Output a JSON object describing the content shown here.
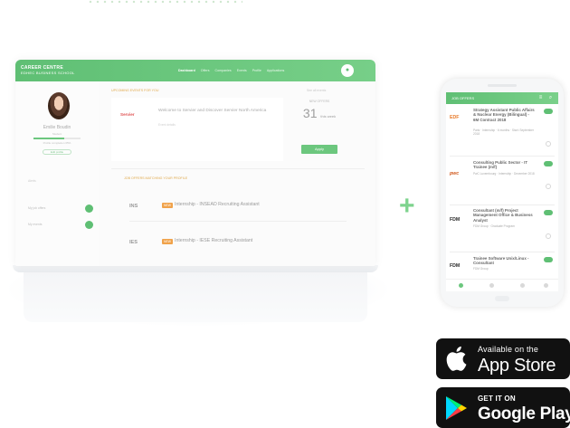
{
  "brand": {
    "line1": "CAREER CENTRE",
    "line2": "EDHEC BUSINESS SCHOOL"
  },
  "nav": [
    "Dashboard",
    "Offers",
    "Companies",
    "Events",
    "Profile",
    "Applications"
  ],
  "profile": {
    "name": "Emilie Boudin",
    "subtitle": "Student",
    "completion": 0.65,
    "completion_label": "Profile completion 65%",
    "edit_label": "Edit profile"
  },
  "sidebar": {
    "section": "Alerts",
    "toggles": [
      "My job offers",
      "My events"
    ]
  },
  "events": {
    "title": "UPCOMING EVENTS FOR YOU",
    "link": "See all events",
    "card_logo": "Servier",
    "card_text": "Welcome to Servier and Discover Servier North America",
    "card_sub": "Event details",
    "count_label": "NEW OFFERS",
    "count_value": "31",
    "count_unit": "this week",
    "count_button": "Apply"
  },
  "offers": {
    "title": "JOB OFFERS MATCHING YOUR PROFILE",
    "rows": [
      {
        "logo": "INS",
        "badge": "NEW",
        "title": "Internship - INSEAD Recruiting Assistant"
      },
      {
        "logo": "IES",
        "badge": "NEW",
        "title": "Internship - IESE Recruiting Assistant"
      }
    ]
  },
  "plus": "+",
  "phone": {
    "bar_title": "JOB OFFERS",
    "menu_icon": "≡",
    "search_icon": "⌕",
    "jobs": [
      {
        "logo": "EDF",
        "title": "Strategy Assistant Public Affairs & Nuclear Energy (Bilingual) - 6M Contract 2018",
        "meta": "Paris · Internship · 6 months · Start: September 2018"
      },
      {
        "logo": "pwc",
        "title": "Consulting Public Sector - IT Trainee (m/f)",
        "meta": "PwC Luxembourg · Internship · December 2018"
      },
      {
        "logo": "FDM",
        "title": "Consultant (m/f) Project Management Office & Business Analyst",
        "meta": "FDM Group · Graduate Program"
      },
      {
        "logo": "FDM",
        "title": "Trainee Software Unix/Linux - Consultant",
        "meta": "FDM Group"
      }
    ]
  },
  "badges": {
    "apple_small": "Available on the",
    "apple_big": "App Store",
    "google_small": "GET IT ON",
    "google_big": "Google Play"
  }
}
